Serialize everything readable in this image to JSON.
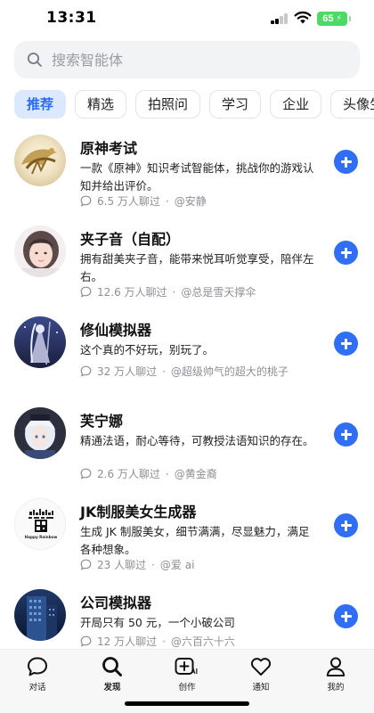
{
  "status_bar": {
    "time": "13:31",
    "battery": "65"
  },
  "search": {
    "placeholder": "搜索智能体"
  },
  "tabs": [
    "推荐",
    "精选",
    "拍照问",
    "学习",
    "企业",
    "头像生"
  ],
  "agents": [
    {
      "name": "原神考试",
      "desc": "一款《原神》知识考试智能体，挑战你的游戏认知并给出评价。",
      "chats": "6.5 万人聊过",
      "author": "@安静"
    },
    {
      "name": "夹子音（自配）",
      "desc": "拥有甜美夹子音，能带来悦耳听觉享受，陪伴左右。",
      "chats": "12.6 万人聊过",
      "author": "@总是雪天撑伞"
    },
    {
      "name": "修仙模拟器",
      "desc": "这个真的不好玩，别玩了。",
      "chats": "32 万人聊过",
      "author": "@超级帅气的超大的桃子"
    },
    {
      "name": "芙宁娜",
      "desc": "精通法语，耐心等待，可教授法语知识的存在。",
      "chats": "2.6 万人聊过",
      "author": "@黄金裔"
    },
    {
      "name": "JK制服美女生成器",
      "desc": "生成 JK 制服美女，细节满满，尽显魅力，满足各种想象。",
      "chats": "23 人聊过",
      "author": "@爱 ai"
    },
    {
      "name": "公司模拟器",
      "desc": "开局只有 50 元，一个小破公司",
      "chats": "12 万人聊过",
      "author": "@六百六十六"
    }
  ],
  "avatar_texts": {
    "jk_logo": "Happy Rainbow"
  },
  "bottom_nav": [
    {
      "label": "对话",
      "icon": "chat-bubble-icon"
    },
    {
      "label": "发现",
      "icon": "search-icon"
    },
    {
      "label": "创作",
      "icon": "create-ai-icon"
    },
    {
      "label": "通知",
      "icon": "heart-icon"
    },
    {
      "label": "我的",
      "icon": "person-icon"
    }
  ],
  "colors": {
    "accent": "#2f6ef5",
    "tab_active_bg": "#dbe8ff",
    "battery": "#4cd964"
  }
}
